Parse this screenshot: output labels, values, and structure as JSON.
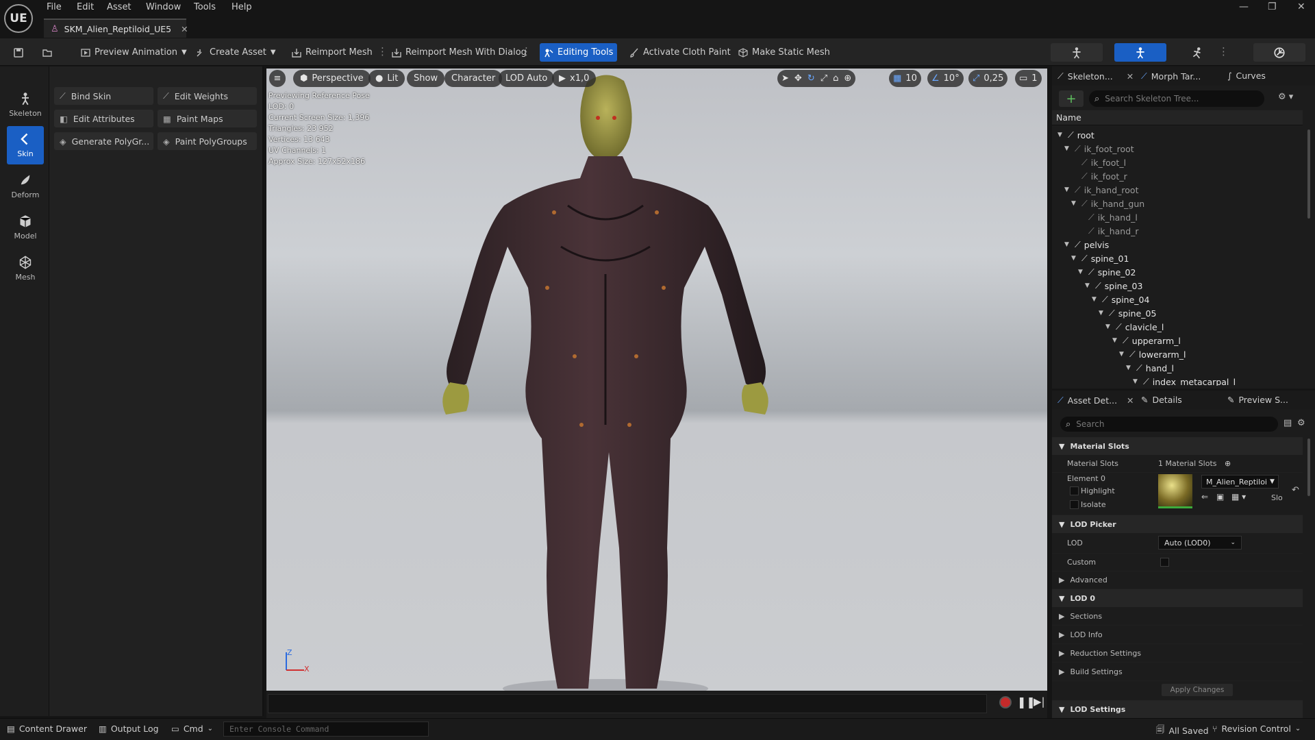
{
  "app": {
    "logo": "UE"
  },
  "menu": [
    "File",
    "Edit",
    "Asset",
    "Window",
    "Tools",
    "Help"
  ],
  "document_tab": {
    "title": "SKM_Alien_Reptiloid_UE5"
  },
  "toolbar": {
    "preview_animation": "Preview Animation",
    "create_asset": "Create Asset",
    "reimport_mesh": "Reimport Mesh",
    "reimport_with_dialog": "Reimport Mesh With Dialog",
    "editing_tools": "Editing Tools",
    "activate_cloth_paint": "Activate Cloth Paint",
    "make_static_mesh": "Make Static Mesh"
  },
  "modes": [
    "Skeleton",
    "Skin",
    "Deform",
    "Model",
    "Mesh"
  ],
  "tools": [
    [
      "Bind Skin",
      "Edit Weights"
    ],
    [
      "Edit Attributes",
      "Paint Maps"
    ],
    [
      "Generate PolyGr...",
      "Paint PolyGroups"
    ]
  ],
  "viewport": {
    "pills": {
      "view": "Perspective",
      "lit": "Lit",
      "show": "Show",
      "character": "Character",
      "lod": "LOD Auto",
      "speed": "x1,0"
    },
    "snap": {
      "grid": "10",
      "angle": "10°",
      "scale": "0,25",
      "camera": "1"
    },
    "info": [
      "Previewing Reference Pose",
      "LOD: 0",
      "Current Screen Size: 1,396",
      "Triangles: 23 952",
      "Vertices: 13 643",
      "UV Channels: 1",
      "Approx Size: 127x52x186"
    ],
    "axis": {
      "z": "Z",
      "x": "X"
    }
  },
  "skeleton_panel": {
    "tabs": [
      "Skeleton...",
      "Morph Tar...",
      "Curves"
    ],
    "search_placeholder": "Search Skeleton Tree...",
    "column": "Name",
    "bones": [
      {
        "name": "root",
        "depth": 0,
        "exp": true
      },
      {
        "name": "ik_foot_root",
        "depth": 1,
        "exp": true,
        "dim": true
      },
      {
        "name": "ik_foot_l",
        "depth": 2,
        "dim": true
      },
      {
        "name": "ik_foot_r",
        "depth": 2,
        "dim": true
      },
      {
        "name": "ik_hand_root",
        "depth": 1,
        "exp": true,
        "dim": true
      },
      {
        "name": "ik_hand_gun",
        "depth": 2,
        "exp": true,
        "dim": true
      },
      {
        "name": "ik_hand_l",
        "depth": 3,
        "dim": true
      },
      {
        "name": "ik_hand_r",
        "depth": 3,
        "dim": true
      },
      {
        "name": "pelvis",
        "depth": 1,
        "exp": true
      },
      {
        "name": "spine_01",
        "depth": 2,
        "exp": true
      },
      {
        "name": "spine_02",
        "depth": 3,
        "exp": true
      },
      {
        "name": "spine_03",
        "depth": 4,
        "exp": true
      },
      {
        "name": "spine_04",
        "depth": 5,
        "exp": true
      },
      {
        "name": "spine_05",
        "depth": 6,
        "exp": true
      },
      {
        "name": "clavicle_l",
        "depth": 7,
        "exp": true
      },
      {
        "name": "upperarm_l",
        "depth": 8,
        "exp": true
      },
      {
        "name": "lowerarm_l",
        "depth": 9,
        "exp": true
      },
      {
        "name": "hand_l",
        "depth": 10,
        "exp": true
      },
      {
        "name": "index_metacarpal_l",
        "depth": 11,
        "exp": true
      }
    ]
  },
  "details_panel": {
    "tabs": [
      "Asset Det...",
      "Details",
      "Preview S..."
    ],
    "search_placeholder": "Search",
    "material_slots": {
      "section": "Material Slots",
      "label": "Material Slots",
      "value": "1 Material Slots",
      "element": "Element 0",
      "highlight": "Highlight",
      "isolate": "Isolate",
      "material": "M_Alien_Reptiloi",
      "slot_short": "Slo"
    },
    "lod_picker": {
      "section": "LOD Picker",
      "lod_label": "LOD",
      "lod_value": "Auto (LOD0)",
      "custom": "Custom"
    },
    "advanced": "Advanced",
    "lod0": {
      "section": "LOD 0",
      "rows": [
        "Sections",
        "LOD Info",
        "Reduction Settings",
        "Build Settings"
      ],
      "apply": "Apply Changes"
    },
    "lod_settings": "LOD Settings"
  },
  "statusbar": {
    "content_drawer": "Content Drawer",
    "output_log": "Output Log",
    "cmd": "Cmd",
    "console_placeholder": "Enter Console Command",
    "all_saved": "All Saved",
    "revision_control": "Revision Control"
  },
  "colors": {
    "accent": "#1a5fc4",
    "panel": "#1c1c1c",
    "toolbar": "#242424"
  }
}
